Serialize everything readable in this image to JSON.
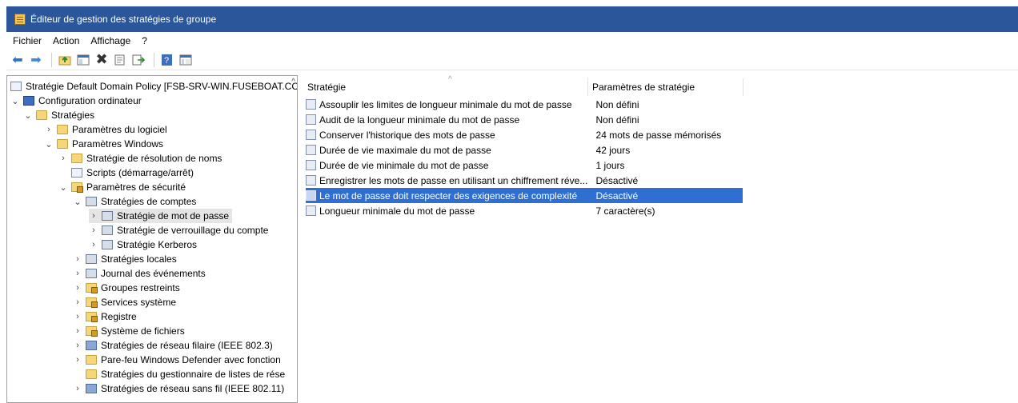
{
  "window": {
    "title": "Éditeur de gestion des stratégies de groupe",
    "app_icon": "policy-editor-icon"
  },
  "menubar": {
    "items": [
      "Fichier",
      "Action",
      "Affichage",
      "?"
    ]
  },
  "toolbar": {
    "buttons": [
      "back-arrow-icon",
      "forward-arrow-icon",
      "up-folder-icon",
      "show-hide-tree-icon",
      "delete-icon",
      "properties-icon",
      "export-list-icon",
      "help-icon",
      "view-icon"
    ]
  },
  "tree": {
    "items": [
      {
        "label": "Stratégie Default Domain Policy [FSB-SRV-WIN.FUSEBOAT.CC",
        "icon": "policy-scroll-icon"
      },
      {
        "label": "Configuration ordinateur",
        "icon": "computer-icon"
      },
      {
        "label": "Stratégies",
        "icon": "folder-icon"
      },
      {
        "label": "Paramètres du logiciel",
        "icon": "folder-icon"
      },
      {
        "label": "Paramètres Windows",
        "icon": "folder-icon"
      },
      {
        "label": "Stratégie de résolution de noms",
        "icon": "folder-icon"
      },
      {
        "label": "Scripts (démarrage/arrêt)",
        "icon": "document-icon"
      },
      {
        "label": "Paramètres de sécurité",
        "icon": "security-settings-icon"
      },
      {
        "label": "Stratégies de comptes",
        "icon": "policy-book-icon"
      },
      {
        "label": "Stratégie de mot de passe",
        "icon": "policy-book-icon"
      },
      {
        "label": "Stratégie de verrouillage du compte",
        "icon": "policy-book-icon"
      },
      {
        "label": "Stratégie Kerberos",
        "icon": "policy-book-icon"
      },
      {
        "label": "Stratégies locales",
        "icon": "policy-book-icon"
      },
      {
        "label": "Journal des événements",
        "icon": "policy-book-icon"
      },
      {
        "label": "Groupes restreints",
        "icon": "locked-folder-icon"
      },
      {
        "label": "Services système",
        "icon": "locked-folder-icon"
      },
      {
        "label": "Registre",
        "icon": "locked-folder-icon"
      },
      {
        "label": "Système de fichiers",
        "icon": "locked-folder-icon"
      },
      {
        "label": "Stratégies de réseau filaire (IEEE 802.3)",
        "icon": "network-policy-icon"
      },
      {
        "label": "Pare-feu Windows Defender avec fonction",
        "icon": "folder-icon"
      },
      {
        "label": "Stratégies du gestionnaire de listes de rése",
        "icon": "folder-icon"
      },
      {
        "label": "Stratégies de réseau sans fil (IEEE 802.11)",
        "icon": "wireless-policy-icon"
      }
    ]
  },
  "list": {
    "columns": {
      "policy": "Stratégie",
      "setting": "Paramètres de stratégie"
    },
    "rows": [
      {
        "policy": "Assouplir les limites de longueur minimale du mot de passe",
        "setting": "Non défini"
      },
      {
        "policy": "Audit de la longueur minimale du mot de passe",
        "setting": "Non défini"
      },
      {
        "policy": "Conserver l'historique des mots de passe",
        "setting": "24 mots de passe mémorisés"
      },
      {
        "policy": "Durée de vie maximale du mot de passe",
        "setting": "42 jours"
      },
      {
        "policy": "Durée de vie minimale du mot de passe",
        "setting": "1 jours"
      },
      {
        "policy": "Enregistrer les mots de passe en utilisant un chiffrement réve...",
        "setting": "Désactivé"
      },
      {
        "policy": "Le mot de passe doit respecter des exigences de complexité",
        "setting": "Désactivé"
      },
      {
        "policy": "Longueur minimale du mot de passe",
        "setting": "7 caractère(s)"
      }
    ],
    "selected_row": 6
  },
  "colors": {
    "title_bar": "#2b579a",
    "selection": "#2e6fd1"
  }
}
